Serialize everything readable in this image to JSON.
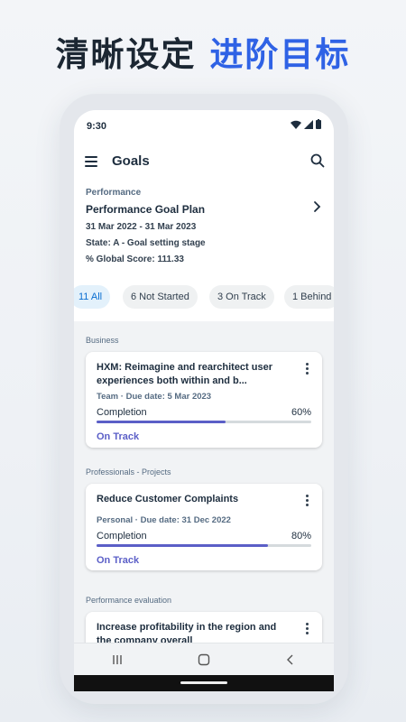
{
  "headline": {
    "main": "清晰设定 ",
    "accent": "进阶目标"
  },
  "statusbar": {
    "time": "9:30"
  },
  "appbar": {
    "title": "Goals"
  },
  "plan": {
    "category": "Performance",
    "name": "Performance Goal Plan",
    "dates": "31 Mar 2022 - 31 Mar 2023",
    "state": "State: A - Goal setting stage",
    "score": "% Global Score: 111.33"
  },
  "filters": [
    {
      "label": "11 All",
      "active": true
    },
    {
      "label": "6 Not Started",
      "active": false
    },
    {
      "label": "3 On Track",
      "active": false
    },
    {
      "label": "1 Behind",
      "active": false
    }
  ],
  "sections": [
    {
      "label": "Business",
      "card": {
        "title": "HXM: Reimagine and rearchitect user experiences both within and b...",
        "meta_type": "Team",
        "meta_due": "Due date: 5 Mar 2023",
        "progress_label": "Completion",
        "progress_value": "60%",
        "progress": 0.6,
        "status": "On Track"
      }
    },
    {
      "label": "Professionals - Projects",
      "card": {
        "title": "Reduce Customer Complaints",
        "meta_type": "Personal",
        "meta_due": "Due date: 31 Dec 2022",
        "progress_label": "Completion",
        "progress_value": "80%",
        "progress": 0.8,
        "status": "On Track"
      }
    },
    {
      "label": "Performance evaluation",
      "card": {
        "title": "Increase profitability in the region and the company overall"
      }
    }
  ],
  "colors": {
    "accent": "#2f62e5",
    "progress": "#5b5fc7",
    "chip_active": "#0a6ed1"
  }
}
